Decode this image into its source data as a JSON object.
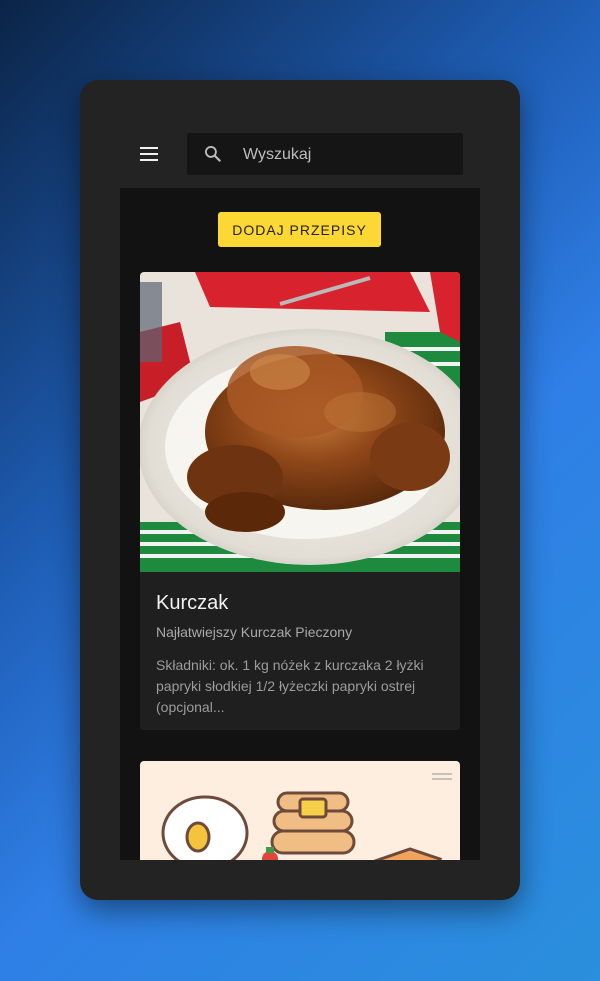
{
  "header": {
    "menu_icon": "menu-icon",
    "search": {
      "placeholder": "Wyszukaj",
      "value": "",
      "icon": "search-icon"
    }
  },
  "main": {
    "add_button_label": "DODAJ PRZEPISY",
    "recipes": [
      {
        "title": "Kurczak",
        "subtitle": "Najłatwiejszy Kurczak Pieczony",
        "description": "Składniki: ok. 1 kg nóżek z kurczaka 2 łyżki papryki słodkiej 1/2 łyżeczki papryki ostrej (opcjonal...",
        "image": "roast-chicken-photo"
      },
      {
        "title": "",
        "subtitle": "",
        "description": "",
        "image": "breakfast-illustration"
      }
    ]
  },
  "colors": {
    "accent": "#fdd835",
    "surface": "#232323",
    "content_bg": "#121212",
    "card_bg": "#1f1f1f"
  }
}
